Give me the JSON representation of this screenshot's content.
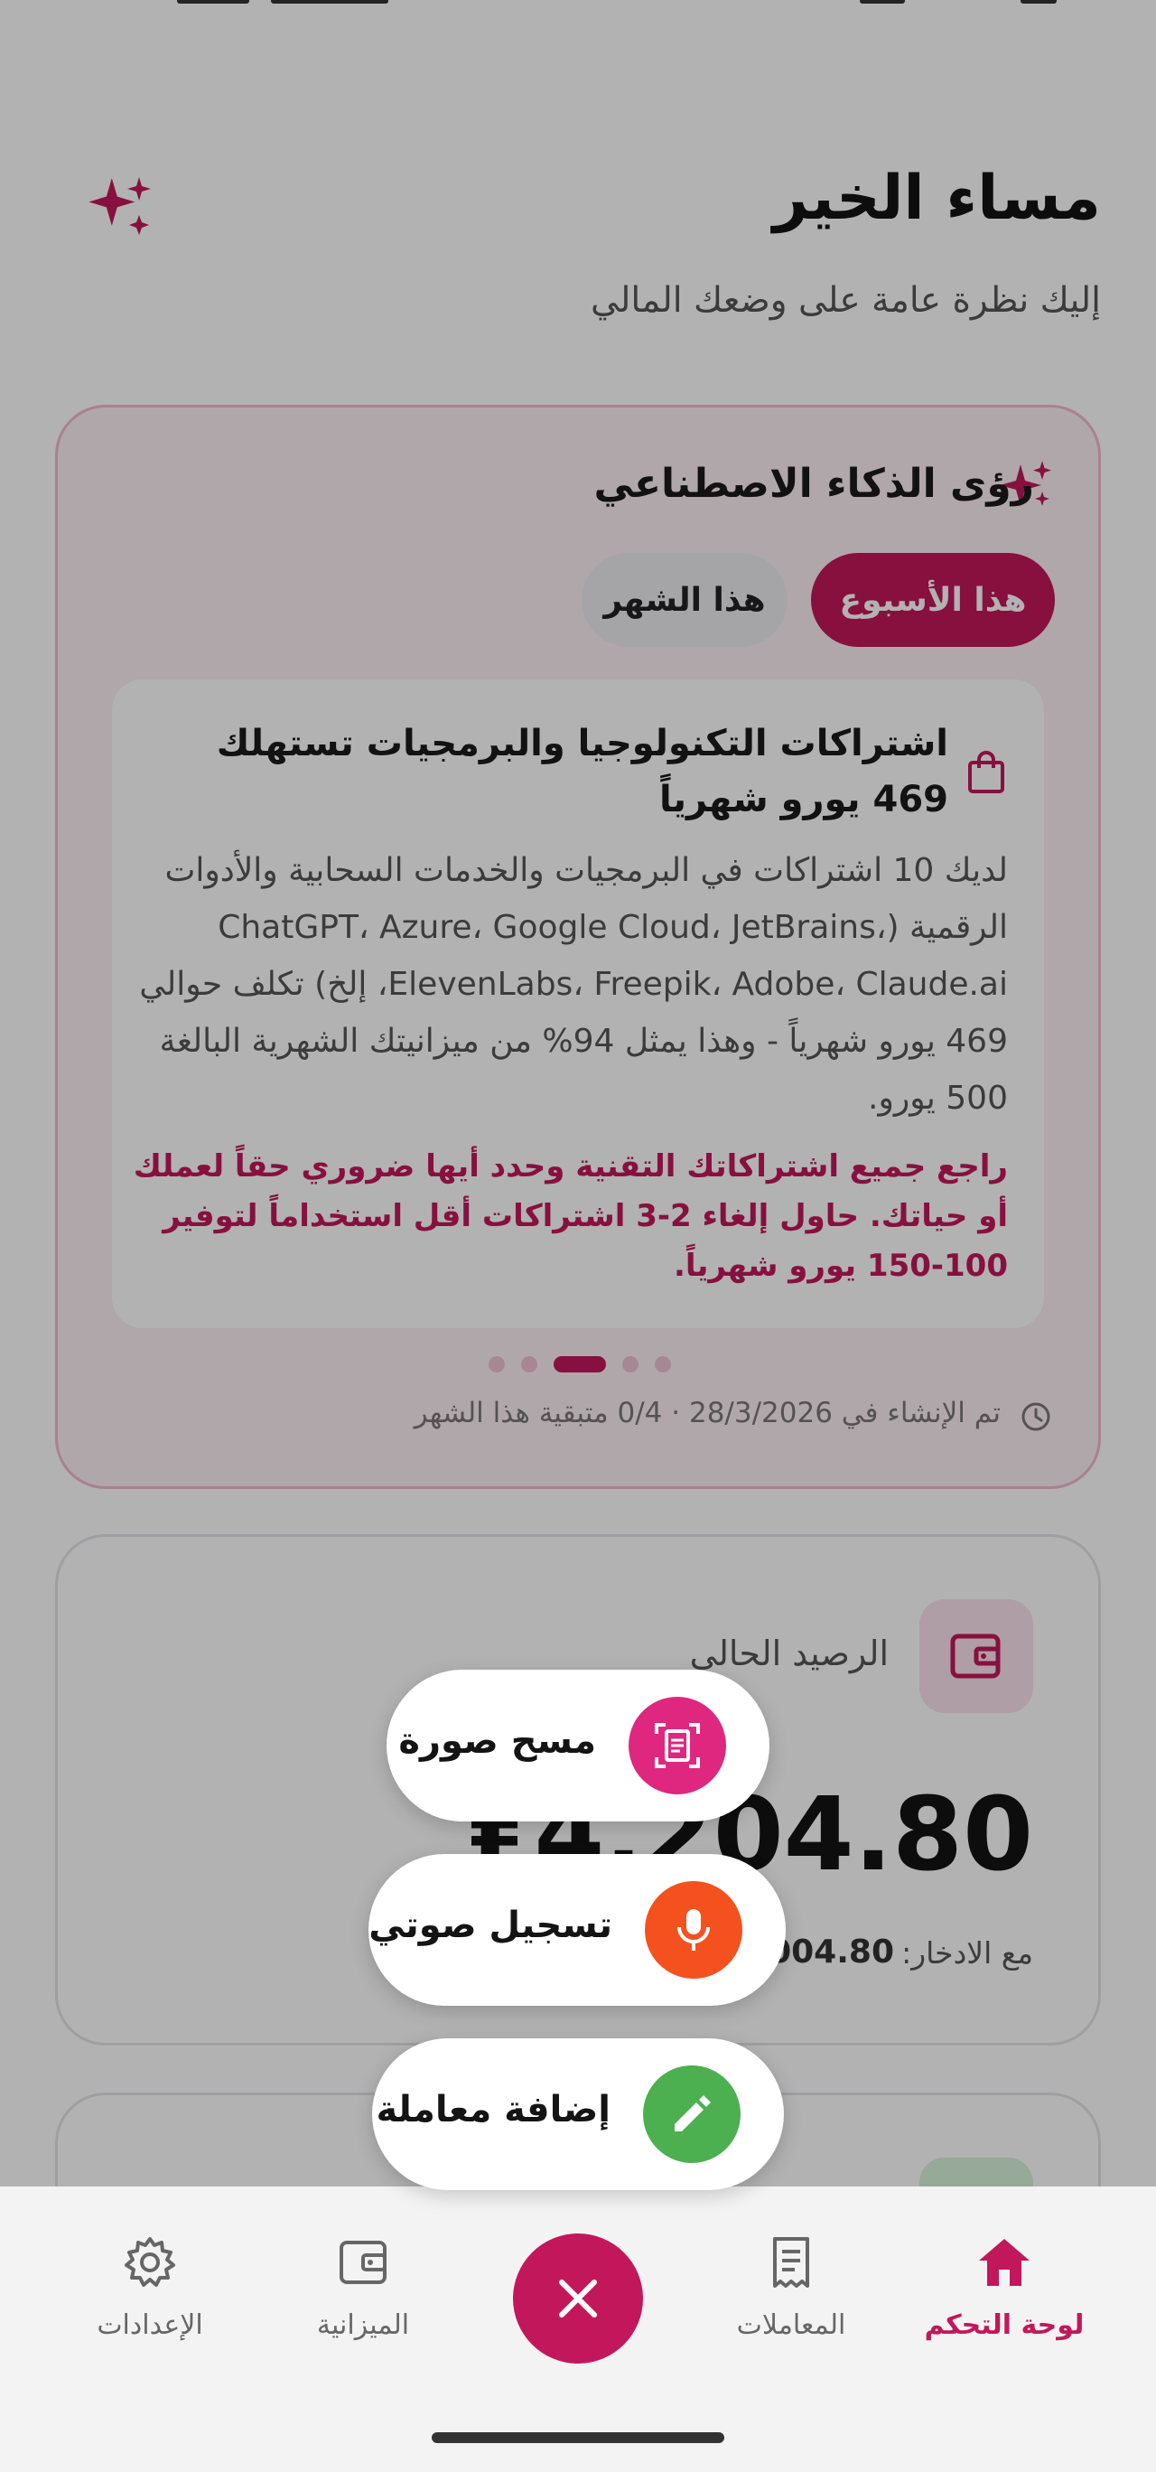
{
  "header": {
    "greeting": "مساء الخير",
    "subtitle": "إليك نظرة عامة على وضعك المالي"
  },
  "insights": {
    "title": "رؤى الذكاء الاصطناعي",
    "tabs": [
      "هذا الأسبوع",
      "هذا الشهر"
    ],
    "selected_tab": "هذا الأسبوع",
    "card": {
      "heading": "اشتراكات التكنولوجيا والبرمجيات تستهلك 469 يورو شهرياً",
      "body": "لديك 10 اشتراكات في البرمجيات والخدمات السحابية والأدوات الرقمية (ChatGPT، Azure، Google Cloud، JetBrains، ElevenLabs، Freepik، Adobe، Claude.ai، إلخ) تكلف حوالي 469 يورو شهرياً - وهذا يمثل 94% من ميزانيتك الشهرية البالغة 500 يورو.",
      "tip": "راجع جميع اشتراكاتك التقنية وحدد أيها ضروري حقاً لعملك أو حياتك. حاول إلغاء 2-3 اشتراكات أقل استخداماً لتوفير 100-150 يورو شهرياً."
    },
    "pager": {
      "count": 5,
      "active_index": 2
    },
    "meta": "تم الإنشاء في 28/3/2026 · 0/4 متبقية هذا الشهر"
  },
  "balance": {
    "label": "الرصيد الحالي",
    "amount": "₤4,204.80",
    "savings_label": "مع الادخار:",
    "savings_value": "004.80"
  },
  "actions": {
    "scan_label": "مسح صورة",
    "voice_label": "تسجيل صوتي",
    "add_label": "إضافة معاملة"
  },
  "nav": {
    "home": "لوحة التحكم",
    "transactions": "المعاملات",
    "budget": "الميزانية",
    "settings": "الإعدادات",
    "active": "home"
  },
  "colors": {
    "accent": "#c2185b",
    "scan": "#e0277f",
    "voice": "#f4511e",
    "add": "#4caf50"
  },
  "icons": {
    "top_right": "sparkles-icon",
    "insights": "sparkles-icon",
    "insight_card": "shopping-bag-icon",
    "meta": "clock-icon",
    "balance": "wallet-icon",
    "scan": "document-scan-icon",
    "voice": "microphone-icon",
    "add": "pencil-icon",
    "close": "close-icon",
    "home": "home-icon",
    "transactions": "receipt-icon",
    "budget": "wallet-icon",
    "settings": "gear-icon"
  }
}
